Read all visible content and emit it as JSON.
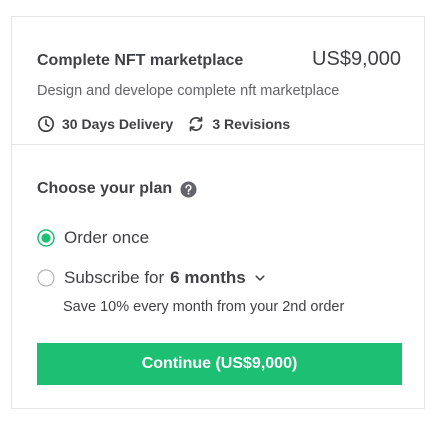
{
  "package": {
    "title": "Complete NFT marketplace",
    "price": "US$9,000",
    "description": "Design and develope complete nft marketplace",
    "delivery": "30 Days Delivery",
    "revisions": "3 Revisions"
  },
  "plan": {
    "title": "Choose your plan",
    "options": [
      {
        "label": "Order once",
        "selected": true
      },
      {
        "label": "Subscribe for",
        "duration": "6 months",
        "selected": false
      }
    ],
    "subscribe_note": "Save 10% every month from your 2nd order"
  },
  "cta": {
    "label": "Continue (US$9,000)"
  },
  "colors": {
    "accent": "#1dbf73",
    "text": "#404145",
    "muted": "#62646a",
    "border": "#e4e5e7"
  },
  "icons": {
    "delivery": "clock-icon",
    "revisions": "refresh-icon",
    "help": "question-circle-icon",
    "duration_dropdown": "chevron-down-icon"
  }
}
